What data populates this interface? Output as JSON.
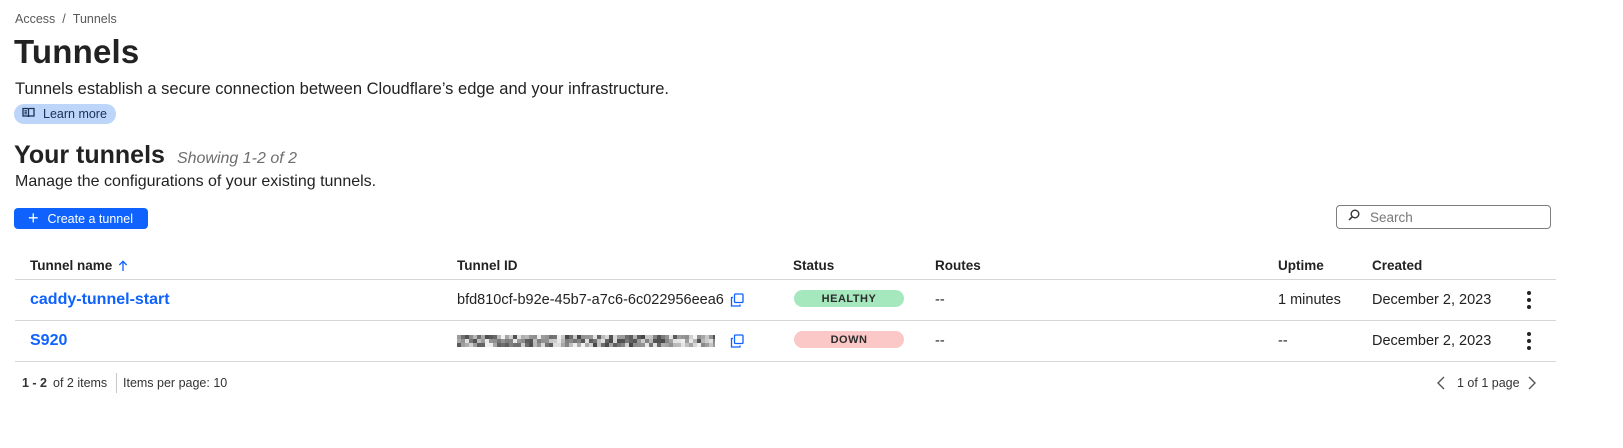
{
  "breadcrumb": {
    "root": "Access",
    "separator": "/",
    "current": "Tunnels"
  },
  "page": {
    "title": "Tunnels",
    "description": "Tunnels establish a secure connection between Cloudflare’s edge and your infrastructure.",
    "learn_more": "Learn more"
  },
  "section": {
    "title": "Your tunnels",
    "showing": "Showing 1-2 of 2",
    "subtitle": "Manage the configurations of your existing tunnels.",
    "create_label": "Create a tunnel"
  },
  "search": {
    "placeholder": "Search"
  },
  "table": {
    "columns": {
      "name": "Tunnel name",
      "id": "Tunnel ID",
      "status": "Status",
      "routes": "Routes",
      "uptime": "Uptime",
      "created": "Created"
    },
    "sort": {
      "column": "Tunnel name",
      "direction": "ascending"
    },
    "rows": [
      {
        "name": "caddy-tunnel-start",
        "id": "bfd810cf-b92e-45b7-a7c6-6c022956eea6",
        "status": "HEALTHY",
        "routes": "--",
        "uptime": "1 minutes",
        "created": "December 2, 2023"
      },
      {
        "name": "S920",
        "id": "",
        "status": "DOWN",
        "routes": "--",
        "uptime": "--",
        "created": "December 2, 2023"
      }
    ]
  },
  "pagination": {
    "range": "1 - 2",
    "total": "of 2 items",
    "per_page": "Items per page: 10",
    "page": "1 of 1 page"
  },
  "colors": {
    "accent": "#0f62fe",
    "healthy": "#a5e8bd",
    "down": "#fbc7c7",
    "learn_more_bg": "#bcd5f9"
  },
  "icons": [
    "book-icon",
    "plus-icon",
    "search-icon",
    "sort-up-arrow-icon",
    "copy-icon",
    "kebab-menu-icon",
    "chevron-left-icon",
    "chevron-right-icon"
  ]
}
